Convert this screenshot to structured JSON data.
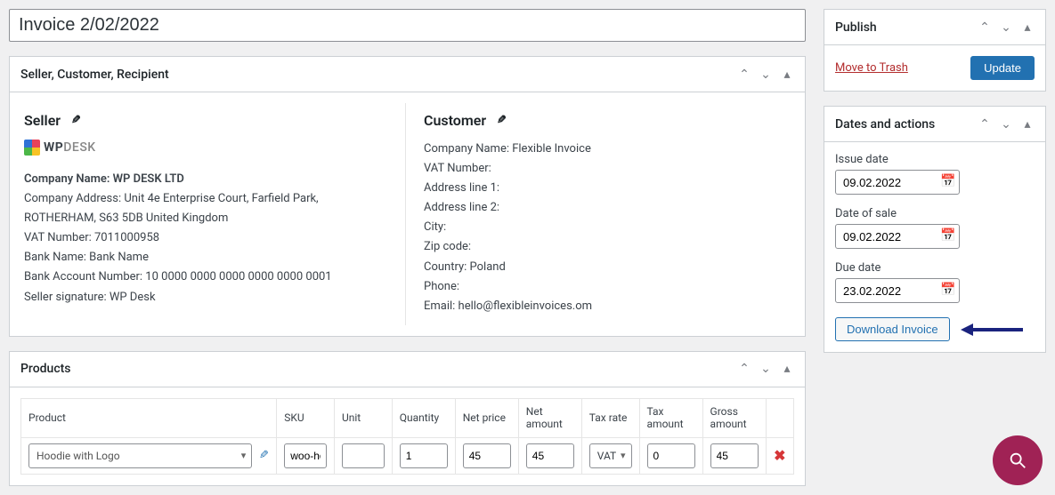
{
  "title": "Invoice 2/02/2022",
  "panels": {
    "seller_title": "Seller, Customer, Recipient",
    "products_title": "Products",
    "publish_title": "Publish",
    "dates_title": "Dates and actions"
  },
  "seller": {
    "heading": "Seller",
    "logo_wp": "WP",
    "logo_desk": "DESK",
    "company_name_label": "Company Name: ",
    "company_name": "WP DESK LTD",
    "address": "Company Address: Unit 4e Enterprise Court, Farfield Park, ROTHERHAM, S63 5DB United Kingdom",
    "vat": "VAT Number: 7011000958",
    "bank_name": "Bank Name: Bank Name",
    "bank_account": "Bank Account Number: 10 0000 0000 0000 0000 0000 0001",
    "signature": "Seller signature: WP Desk"
  },
  "customer": {
    "heading": "Customer",
    "company_name": "Company Name: Flexible Invoice",
    "vat": "VAT Number:",
    "addr1": "Address line 1:",
    "addr2": "Address line 2:",
    "city": "City:",
    "zip": "Zip code:",
    "country": "Country: Poland",
    "phone": "Phone:",
    "email": "Email: hello@flexibleinvoices.om"
  },
  "products": {
    "headers": {
      "product": "Product",
      "sku": "SKU",
      "unit": "Unit",
      "qty": "Quantity",
      "net_price": "Net price",
      "net_amount": "Net amount",
      "tax_rate": "Tax rate",
      "tax_amount": "Tax amount",
      "gross_amount": "Gross amount"
    },
    "rows": [
      {
        "name": "Hoodie with Logo",
        "sku": "woo-ho",
        "unit": "",
        "qty": "1",
        "net_price": "45",
        "net_amount": "45",
        "tax_rate": "VAT",
        "tax_amount": "0",
        "gross_amount": "45"
      }
    ]
  },
  "publish": {
    "trash": "Move to Trash",
    "update": "Update"
  },
  "dates": {
    "issue_label": "Issue date",
    "issue_value": "09.02.2022",
    "sale_label": "Date of sale",
    "sale_value": "09.02.2022",
    "due_label": "Due date",
    "due_value": "23.02.2022",
    "download": "Download Invoice"
  }
}
